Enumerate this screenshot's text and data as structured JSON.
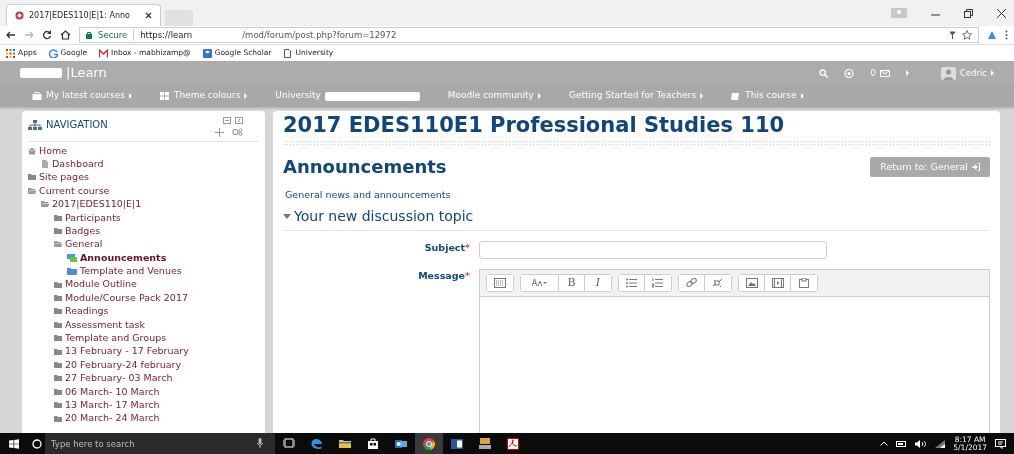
{
  "browser": {
    "tab_title": "2017|EDES110|E|1: Anno",
    "secure_label": "Secure",
    "url_host": "https://learn",
    "url_path": "/mod/forum/post.php?forum=12972",
    "bookmarks": [
      {
        "kind": "apps",
        "label": "Apps"
      },
      {
        "kind": "google",
        "label": "Google"
      },
      {
        "kind": "mail",
        "label": "Inbox - mabhizamp@"
      },
      {
        "kind": "scholar",
        "label": "Google Scholar"
      },
      {
        "kind": "page",
        "label": "University"
      }
    ]
  },
  "site": {
    "brand": "|Learn",
    "messages_count": "0",
    "user": "Cedric",
    "menu": [
      {
        "kind": "briefcase",
        "label": "My latest courses"
      },
      {
        "kind": "grid",
        "label": "Theme colours"
      },
      {
        "kind": "redacted",
        "label": "University"
      },
      {
        "kind": "plain",
        "label": "Moodle community"
      },
      {
        "kind": "plain",
        "label": "Getting Started for Teachers"
      },
      {
        "kind": "book",
        "label": "This course"
      }
    ]
  },
  "navigation": {
    "title": "NAVIGATION",
    "items": [
      {
        "kind": "home",
        "label": "Home",
        "selected": false,
        "children": [
          {
            "kind": "page",
            "label": "Dashboard",
            "selected": false
          }
        ]
      },
      {
        "kind": "folder",
        "label": "Site pages",
        "selected": false
      },
      {
        "kind": "folder-open",
        "label": "Current course",
        "selected": false,
        "children": [
          {
            "kind": "folder-open",
            "label": "2017|EDES110|E|1",
            "selected": false,
            "children": [
              {
                "kind": "folder",
                "label": "Participants",
                "selected": false
              },
              {
                "kind": "folder",
                "label": "Badges",
                "selected": false
              },
              {
                "kind": "folder-open",
                "label": "General",
                "selected": false,
                "children": [
                  {
                    "kind": "forum",
                    "label": "Announcements",
                    "selected": true
                  },
                  {
                    "kind": "resource",
                    "label": "Template and Venues",
                    "selected": false
                  }
                ]
              },
              {
                "kind": "folder",
                "label": "Module Outline",
                "selected": false
              },
              {
                "kind": "folder",
                "label": "Module/Course Pack 2017",
                "selected": false
              },
              {
                "kind": "folder",
                "label": "Readings",
                "selected": false
              },
              {
                "kind": "folder",
                "label": "Assessment task",
                "selected": false
              },
              {
                "kind": "folder",
                "label": "Template and Groups",
                "selected": false
              },
              {
                "kind": "folder",
                "label": "13 February - 17 February",
                "selected": false
              },
              {
                "kind": "folder",
                "label": "20 February-24 february",
                "selected": false
              },
              {
                "kind": "folder",
                "label": "27 February- 03 March",
                "selected": false
              },
              {
                "kind": "folder",
                "label": "06 March- 10 March",
                "selected": false
              },
              {
                "kind": "folder",
                "label": "13 March- 17 March",
                "selected": false
              },
              {
                "kind": "folder",
                "label": "20 March- 24 March",
                "selected": false
              }
            ]
          }
        ]
      }
    ]
  },
  "main": {
    "course_title": "2017 EDES110E1 Professional Studies 110",
    "heading": "Announcements",
    "return_button": "Return to: General",
    "description": "General news and announcements",
    "section": {
      "title": "Your new discussion topic",
      "expanded": true
    },
    "fields": [
      {
        "kind": "text",
        "label": "Subject",
        "required_mark": "*"
      },
      {
        "kind": "editor",
        "label": "Message",
        "required_mark": "*"
      }
    ],
    "toolbar": [
      [
        {
          "kind": "toggle"
        }
      ],
      [
        {
          "kind": "font"
        },
        {
          "kind": "bold",
          "label": "B"
        },
        {
          "kind": "italic",
          "label": "I"
        }
      ],
      [
        {
          "kind": "bullets"
        },
        {
          "kind": "numbers"
        }
      ],
      [
        {
          "kind": "link"
        },
        {
          "kind": "unlink"
        }
      ],
      [
        {
          "kind": "image"
        },
        {
          "kind": "media"
        },
        {
          "kind": "paste"
        }
      ]
    ]
  },
  "taskbar": {
    "search_placeholder": "Type here to search",
    "time": "8:17 AM",
    "date": "5/1/2017"
  }
}
